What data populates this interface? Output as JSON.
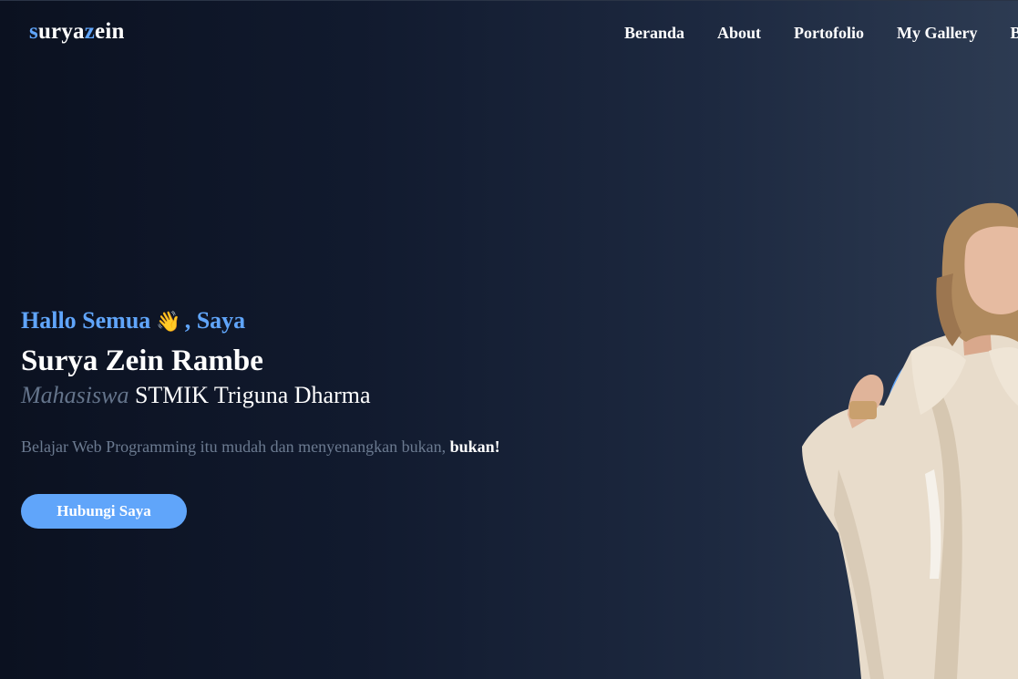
{
  "logo": {
    "part1": "s",
    "part2": "urya",
    "part3": "z",
    "part4": "ein"
  },
  "nav": {
    "items": [
      {
        "label": "Beranda"
      },
      {
        "label": "About"
      },
      {
        "label": "Portofolio"
      },
      {
        "label": "My Gallery"
      },
      {
        "label": "B"
      }
    ]
  },
  "hero": {
    "greeting_text": "Hallo Semua",
    "greeting_emoji": "👋",
    "greeting_suffix": ", Saya",
    "name": "Surya Zein Rambe",
    "role_prefix": "Mahasiswa",
    "role_campus": "STMIK Triguna Dharma",
    "tagline": "Belajar Web Programming itu mudah dan menyenangkan bukan,",
    "tagline_bold": "bukan!",
    "cta_label": "Hubungi Saya"
  },
  "colors": {
    "accent": "#60a5fa",
    "background_dark": "#0b1120",
    "background_light": "#2d3b52"
  },
  "icons": {
    "greeting": "waving-hand-icon"
  }
}
